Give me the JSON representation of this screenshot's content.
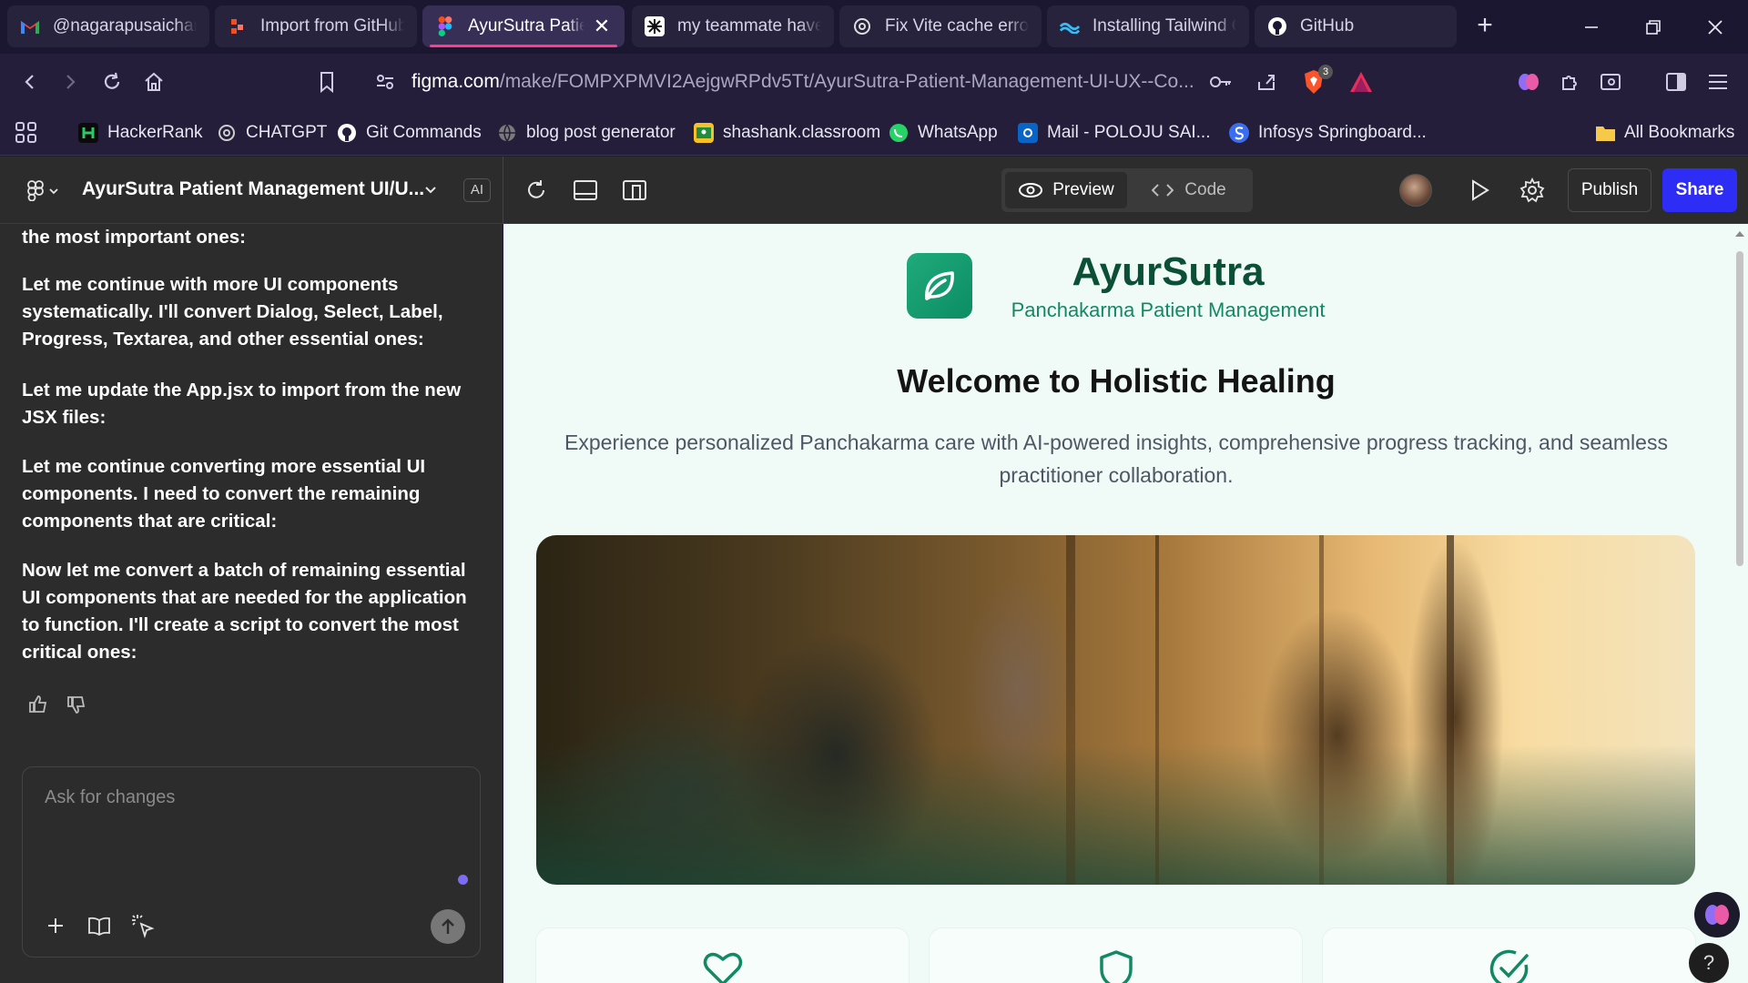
{
  "browser": {
    "tabs": [
      {
        "title": "@nagarapusaichar",
        "icon": "gmail-icon"
      },
      {
        "title": "Import from GitHub",
        "icon": "figma-make-icon"
      },
      {
        "title": "AyurSutra Patient",
        "icon": "figma-icon"
      },
      {
        "title": "my teammate have",
        "icon": "app-icon"
      },
      {
        "title": "Fix Vite cache error",
        "icon": "chatgpt-icon"
      },
      {
        "title": "Installing Tailwind C",
        "icon": "windsurf-icon"
      },
      {
        "title": "GitHub",
        "icon": "github-icon"
      }
    ],
    "active_tab_close": "✕",
    "url_host": "figma.com",
    "url_path": "/make/FOMPXPMVI2AejgwRPdv5Tt/AyurSutra-Patient-Management-UI-UX--Co...",
    "brave_badge": "3",
    "bookmarks": [
      {
        "label": "HackerRank",
        "icon": "hackerrank-icon",
        "color": "#2ec866"
      },
      {
        "label": "CHATGPT",
        "icon": "chatgpt-icon",
        "color": "#cccccc"
      },
      {
        "label": "Git Commands",
        "icon": "github-icon",
        "color": "#ffffff"
      },
      {
        "label": "blog post generator",
        "icon": "globe-icon",
        "color": "#9a9a9a"
      },
      {
        "label": "shashank.classroom",
        "icon": "classroom-icon",
        "color": "#f6c026"
      },
      {
        "label": "WhatsApp",
        "icon": "whatsapp-icon",
        "color": "#25d366"
      },
      {
        "label": "Mail - POLOJU SAI...",
        "icon": "outlook-icon",
        "color": "#0a64c8"
      },
      {
        "label": "Infosys Springboard...",
        "icon": "springboard-icon",
        "color": "#3b6df0"
      }
    ],
    "all_bookmarks": "All Bookmarks"
  },
  "figma": {
    "project_title": "AyurSutra Patient Management UI/U...",
    "ai_chip": "AI",
    "preview_label": "Preview",
    "code_label": "Code",
    "publish_label": "Publish",
    "share_label": "Share",
    "accent": "#2d2df5"
  },
  "chat": {
    "messages": [
      "the most important ones:",
      "Let me continue with more UI components systematically. I'll convert Dialog, Select, Label, Progress, Textarea, and other essential ones:",
      "Let me update the App.jsx to import from the new JSX files:",
      "Let me continue converting more essential UI components. I need to convert the remaining components that are critical:",
      "Now let me convert a batch of remaining essential UI components that are needed for the application to function. I'll create a script to convert the most critical ones:"
    ],
    "composer_placeholder": "Ask for changes"
  },
  "app": {
    "brand": "AyurSutra",
    "tagline": "Panchakarma Patient Management",
    "hero_title": "Welcome to Holistic Healing",
    "hero_subtitle": "Experience personalized Panchakarma care with AI-powered insights, comprehensive progress tracking, and seamless practitioner collaboration.",
    "brand_color": "#0b4f37",
    "accent_green": "#118a63",
    "feature_icons": [
      "heart-icon",
      "shield-icon",
      "check-circle-icon"
    ],
    "help_label": "?"
  }
}
